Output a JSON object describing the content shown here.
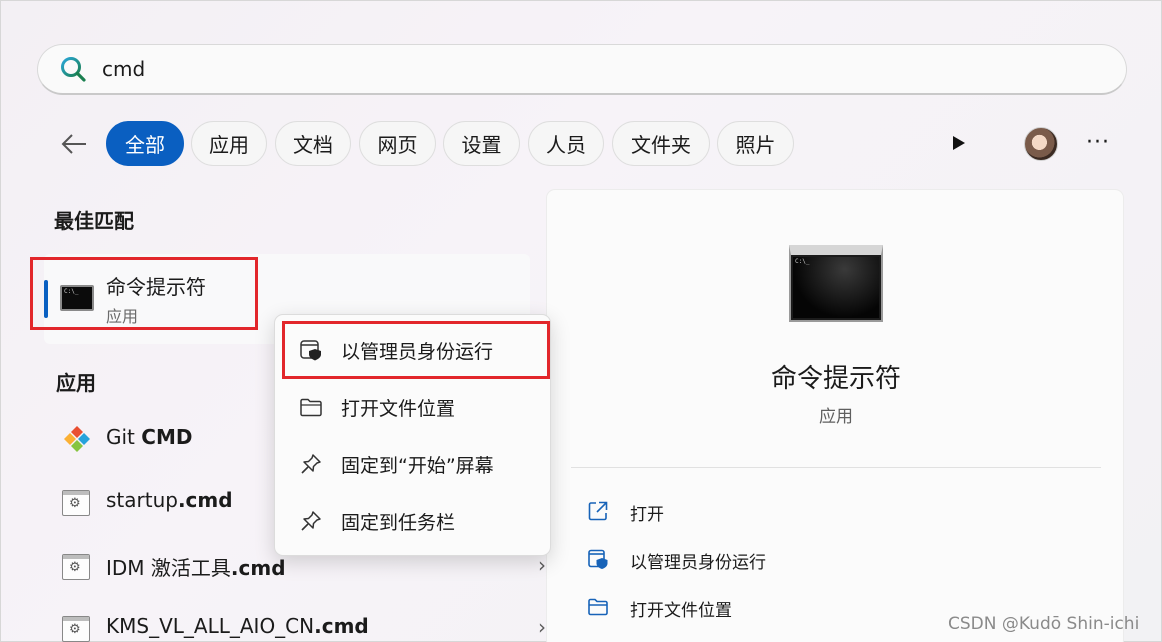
{
  "search": {
    "value": "cmd",
    "icon": "search-icon"
  },
  "filters": [
    "全部",
    "应用",
    "文档",
    "网页",
    "设置",
    "人员",
    "文件夹",
    "照片"
  ],
  "left": {
    "best_match_title": "最佳匹配",
    "best_match": {
      "name": "命令提示符",
      "type": "应用",
      "icon": "terminal-icon"
    },
    "apps_title": "应用",
    "apps": [
      {
        "prefix": "Git ",
        "bold": "CMD",
        "icon": "git-icon"
      },
      {
        "prefix": "startup",
        "bold": ".cmd",
        "icon": "script-icon"
      },
      {
        "prefix": "IDM 激活工具",
        "bold": ".cmd",
        "icon": "script-icon"
      },
      {
        "prefix": "KMS_VL_ALL_AIO_CN",
        "bold": ".cmd",
        "icon": "script-icon"
      }
    ]
  },
  "context_menu": [
    {
      "label": "以管理员身份运行",
      "icon": "admin-shield-icon"
    },
    {
      "label": "打开文件位置",
      "icon": "folder-icon"
    },
    {
      "label": "固定到“开始”屏幕",
      "icon": "pin-icon"
    },
    {
      "label": "固定到任务栏",
      "icon": "pin-icon"
    }
  ],
  "panel": {
    "title": "命令提示符",
    "subtitle": "应用",
    "actions": [
      {
        "label": "打开",
        "icon": "open-external-icon"
      },
      {
        "label": "以管理员身份运行",
        "icon": "admin-shield-icon"
      },
      {
        "label": "打开文件位置",
        "icon": "folder-icon"
      }
    ]
  },
  "watermark": "CSDN @Kudō Shin-ichi",
  "colors": {
    "accent": "#0a5fc1",
    "highlight_box": "#e2262b"
  }
}
